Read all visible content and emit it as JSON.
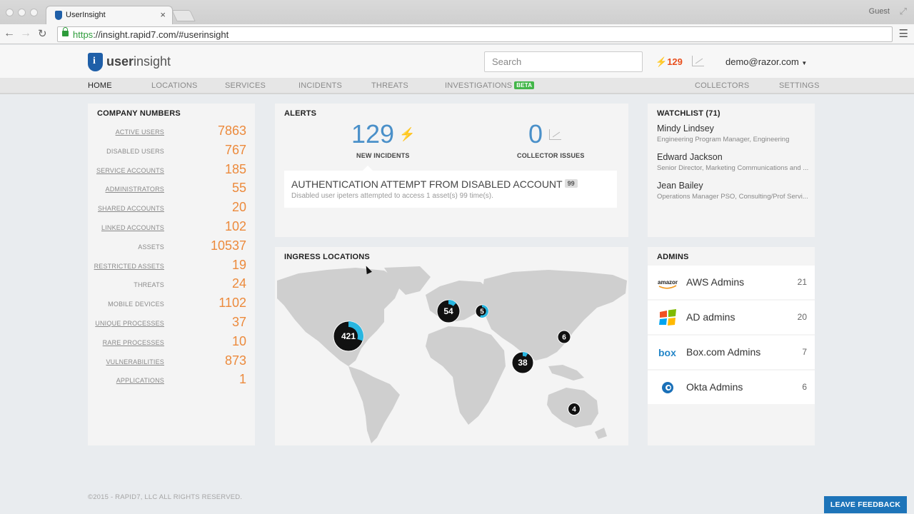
{
  "browser": {
    "tab_title": "UserInsight",
    "tab_close": "×",
    "url_scheme": "https",
    "url_rest": "://insight.rapid7.com/#userinsight",
    "profile": "Guest"
  },
  "header": {
    "logo_bold": "user",
    "logo_light": "insight",
    "search_placeholder": "Search",
    "alert_count": "129",
    "user_email": "demo@razor.com"
  },
  "nav": {
    "home": "HOME",
    "locations": "LOCATIONS",
    "services": "SERVICES",
    "incidents": "INCIDENTS",
    "threats": "THREATS",
    "investigations": "INVESTIGATIONS",
    "beta": "BETA",
    "collectors": "COLLECTORS",
    "settings": "SETTINGS"
  },
  "company_numbers": {
    "title": "COMPANY NUMBERS",
    "rows": [
      {
        "label": "ACTIVE USERS",
        "value": "7863"
      },
      {
        "label": "DISABLED USERS",
        "value": "767"
      },
      {
        "label": "SERVICE ACCOUNTS",
        "value": "185"
      },
      {
        "label": "ADMINISTRATORS",
        "value": "55"
      },
      {
        "label": "SHARED ACCOUNTS",
        "value": "20"
      },
      {
        "label": "LINKED ACCOUNTS",
        "value": "102"
      },
      {
        "label": "ASSETS",
        "value": "10537"
      },
      {
        "label": "RESTRICTED ASSETS",
        "value": "19"
      },
      {
        "label": "THREATS",
        "value": "24"
      },
      {
        "label": "MOBILE DEVICES",
        "value": "1102"
      },
      {
        "label": "UNIQUE PROCESSES",
        "value": "37"
      },
      {
        "label": "RARE PROCESSES",
        "value": "10"
      },
      {
        "label": "VULNERABILITIES",
        "value": "873"
      },
      {
        "label": "APPLICATIONS",
        "value": "1"
      }
    ]
  },
  "alerts": {
    "title": "ALERTS",
    "new_incidents_value": "129",
    "new_incidents_label": "NEW INCIDENTS",
    "collector_issues_value": "0",
    "collector_issues_label": "COLLECTOR ISSUES",
    "card_title": "AUTHENTICATION ATTEMPT FROM DISABLED ACCOUNT",
    "card_count": "99",
    "card_desc": "Disabled user ipeters attempted to access 1 asset(s) 99 time(s)."
  },
  "watchlist": {
    "title": "WATCHLIST (71)",
    "people": [
      {
        "name": "Mindy Lindsey",
        "role": "Engineering Program Manager, Engineering"
      },
      {
        "name": "Edward Jackson",
        "role": "Senior Director, Marketing Communications and ..."
      },
      {
        "name": "Jean Bailey",
        "role": "Operations Manager PSO, Consulting/Prof Servi..."
      }
    ]
  },
  "ingress": {
    "title": "INGRESS LOCATIONS",
    "clusters": [
      {
        "label": "421",
        "highlight_fraction": 0.3
      },
      {
        "label": "54",
        "highlight_fraction": 0.12
      },
      {
        "label": "5",
        "highlight_fraction": 0.55
      },
      {
        "label": "6",
        "highlight_fraction": 0
      },
      {
        "label": "38",
        "highlight_fraction": 0.08
      },
      {
        "label": "4",
        "highlight_fraction": 0
      }
    ]
  },
  "admins": {
    "title": "ADMINS",
    "groups": [
      {
        "name": "AWS Admins",
        "count": "21",
        "icon": "amazon-icon",
        "icon_text": "amazon"
      },
      {
        "name": "AD admins",
        "count": "20",
        "icon": "windows-icon"
      },
      {
        "name": "Box.com Admins",
        "count": "7",
        "icon": "box-icon",
        "icon_text": "box"
      },
      {
        "name": "Okta Admins",
        "count": "6",
        "icon": "okta-icon"
      }
    ]
  },
  "footer": {
    "copyright": "©2015 - RAPID7, LLC ALL RIGHTS RESERVED.",
    "feedback": "LEAVE FEEDBACK"
  },
  "colors": {
    "accent_blue": "#4a90c9",
    "number_orange": "#ec8a3c",
    "alert_red": "#e94f1d",
    "beta_green": "#43b649",
    "pie_cyan": "#29b6e0"
  }
}
